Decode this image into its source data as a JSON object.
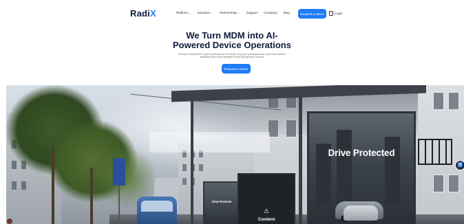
{
  "nav": {
    "logo": {
      "text": "Radi",
      "accent": "X"
    },
    "menu": [
      {
        "label": "Platform",
        "has_dropdown": true
      },
      {
        "label": "Solutions",
        "has_dropdown": true
      },
      {
        "label": "Partnerships",
        "has_dropdown": true
      },
      {
        "label": "Support",
        "has_dropdown": false
      },
      {
        "label": "Company",
        "has_dropdown": false
      },
      {
        "label": "Blog",
        "has_dropdown": false
      }
    ],
    "cta_label": "Request a Demo",
    "login_label": "Login"
  },
  "hero": {
    "title_line1": "We Turn MDM into AI-",
    "title_line2": "Powered Device Operations",
    "subtitle": "Drive your device fleet to optimal performance and health, drop your operational costs, and boost customer satisfaction with Radix Intelligent Device Management Solutions",
    "cta_label": "Request a Demo"
  },
  "scene": {
    "big_sign_text": "Drive Protected",
    "small_sign_text": "Drive Protecte",
    "middle_sign_text": "Content"
  },
  "colors": {
    "brand_dark": "#0d1b3d",
    "accent": "#1f7cf6"
  }
}
